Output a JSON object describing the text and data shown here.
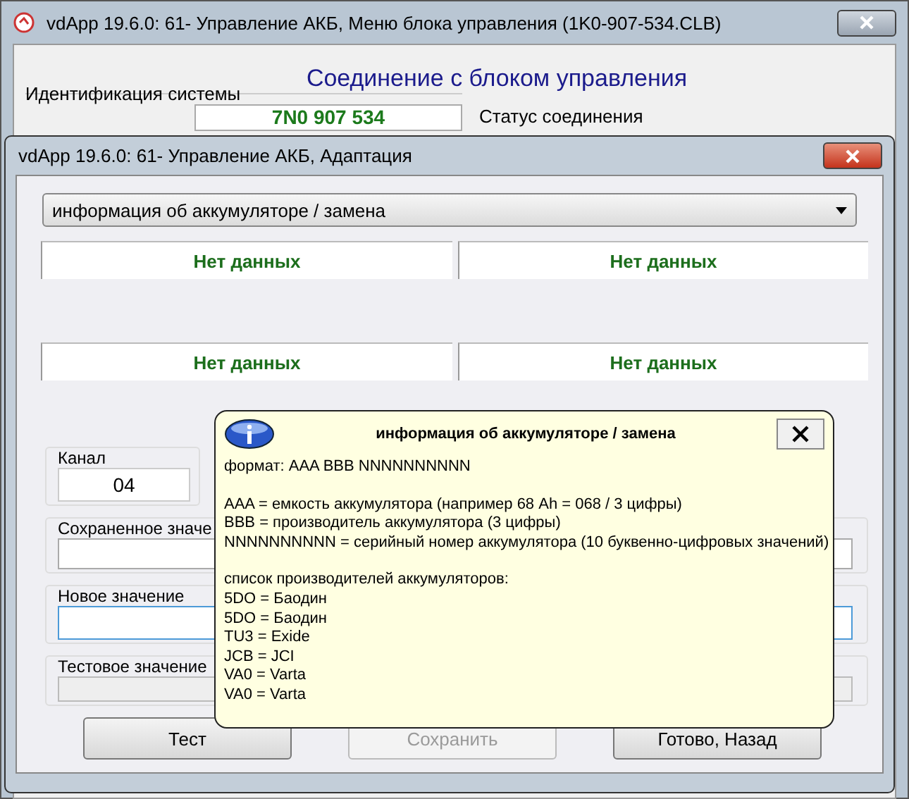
{
  "background_window": {
    "title": "vdApp 19.6.0: 61- Управление АКБ,  Меню блока управления (1K0-907-534.CLB)",
    "heading": "Соединение с блоком управления",
    "identification_group": "Идентификация системы",
    "part_number": "7N0 907 534",
    "status_group": "Статус соединения"
  },
  "dialog": {
    "title": "vdApp 19.6.0: 61- Управление АКБ, Адаптация",
    "dropdown": {
      "value": "информация об аккумуляторе / замена"
    },
    "data_cells": [
      "Нет данных",
      "Нет данных",
      "Нет данных",
      "Нет данных"
    ],
    "channel": {
      "label": "Канал",
      "value": "04"
    },
    "fields": [
      {
        "label": "Сохраненное значе",
        "disabled": false,
        "focused": false
      },
      {
        "label": "Новое значение",
        "disabled": false,
        "focused": true
      },
      {
        "label": "Тестовое значение",
        "disabled": true,
        "focused": false
      }
    ],
    "buttons": [
      {
        "label": "Тест",
        "disabled": false
      },
      {
        "label": "Сохранить",
        "disabled": true
      },
      {
        "label": "Готово, Назад",
        "disabled": false
      }
    ]
  },
  "popup": {
    "title": "информация об аккумуляторе / замена",
    "paragraphs": [
      [
        "формат: AAA BBB NNNNNNNNNN"
      ],
      [
        "AAA = емкость аккумулятора (например 68 Ah = 068 / 3 цифры)",
        "BBB = производитель аккумулятора (3 цифры)",
        "NNNNNNNNNN = серийный номер аккумулятора (10 буквенно-цифровых значений)"
      ],
      [
        "список производителей аккумуляторов:",
        "5DO = Баодин",
        "5DO = Баодин",
        "TU3 = Exide",
        "JCB = JCI",
        "VA0 = Varta",
        "VA0 = Varta"
      ]
    ]
  }
}
